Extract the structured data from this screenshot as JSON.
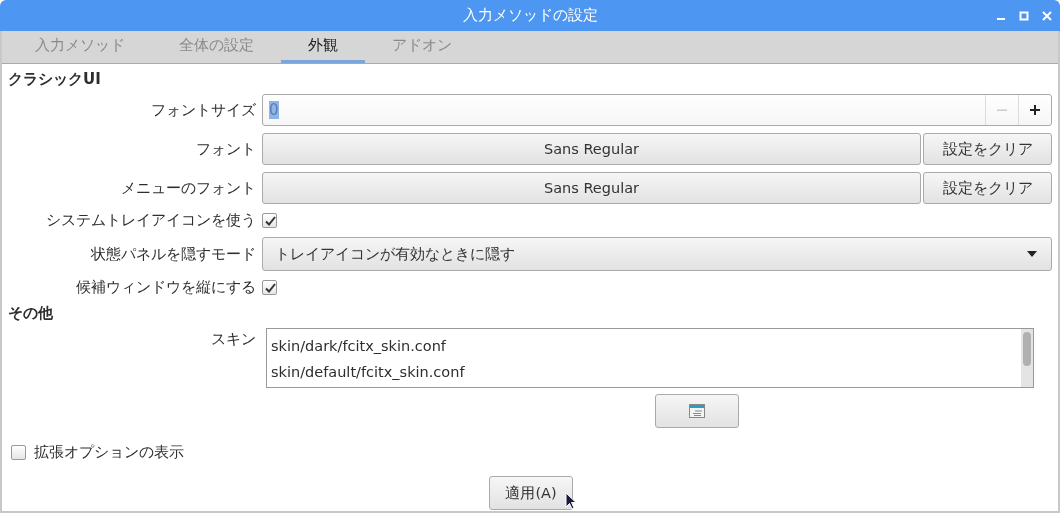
{
  "window": {
    "title": "入力メソッドの設定"
  },
  "tabs": [
    {
      "label": "入力メソッド",
      "selected": false
    },
    {
      "label": "全体の設定",
      "selected": false
    },
    {
      "label": "外観",
      "selected": true
    },
    {
      "label": "アドオン",
      "selected": false
    }
  ],
  "sections": [
    {
      "title": "クラシックUI",
      "rows": [
        {
          "kind": "spin",
          "label": "フォントサイズ",
          "value": "0",
          "minus_disabled": true
        },
        {
          "kind": "font",
          "label": "フォント",
          "value": "Sans Regular",
          "clear": "設定をクリア"
        },
        {
          "kind": "font",
          "label": "メニューのフォント",
          "value": "Sans Regular",
          "clear": "設定をクリア"
        },
        {
          "kind": "checkbox",
          "label": "システムトレイアイコンを使う",
          "checked": true
        },
        {
          "kind": "select",
          "label": "状態パネルを隠すモード",
          "value": "トレイアイコンが有効なときに隠す"
        },
        {
          "kind": "checkbox",
          "label": "候補ウィンドウを縦にする",
          "checked": true
        }
      ]
    },
    {
      "title": "その他",
      "rows": [
        {
          "kind": "list",
          "label": "スキン",
          "items": [
            "skin/dark/fcitx_skin.conf",
            "skin/default/fcitx_skin.conf"
          ]
        }
      ]
    }
  ],
  "advanced": {
    "label": "拡張オプションの表示",
    "checked": false
  },
  "apply_button": "適用(A)"
}
